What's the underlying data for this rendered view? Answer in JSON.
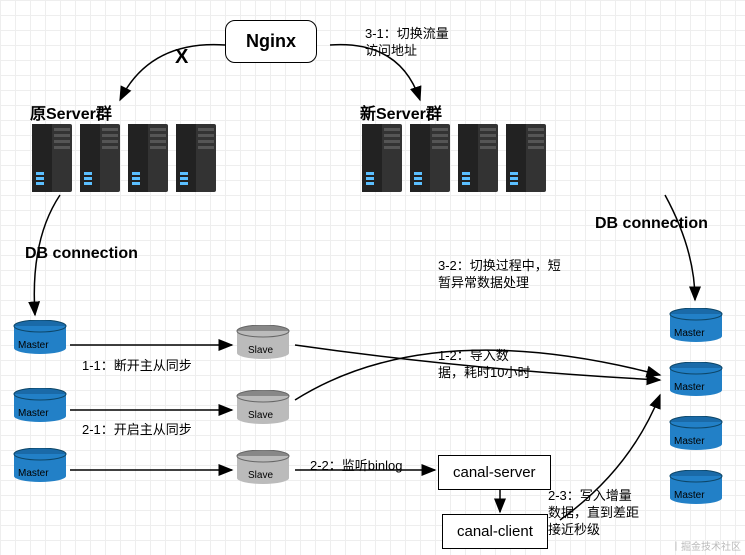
{
  "nginx": {
    "label": "Nginx"
  },
  "cluster_old": {
    "title": "原Server群"
  },
  "cluster_new": {
    "title": "新Server群"
  },
  "db_conn_left": "DB connection",
  "db_conn_right": "DB connection",
  "x_mark": "X",
  "step_3_1": "3-1：切换流量\n访问地址",
  "step_1_1": "1-1：断开主从同步",
  "step_2_1": "2-1：开启主从同步",
  "step_2_2": "2-2：监听binlog",
  "step_1_2": "1-2：导入数\n据，耗时10小时",
  "step_3_2": "3-2：切换过程中，短\n暂异常数据处理",
  "step_2_3": "2-3：写入增量\n数据，直到差距\n接近秒级",
  "canal_server": {
    "label": "canal-server"
  },
  "canal_client": {
    "label": "canal-client"
  },
  "db": {
    "master_label": "Master",
    "slave_label": "Slave"
  },
  "watermark": "丨掘金技术社区"
}
